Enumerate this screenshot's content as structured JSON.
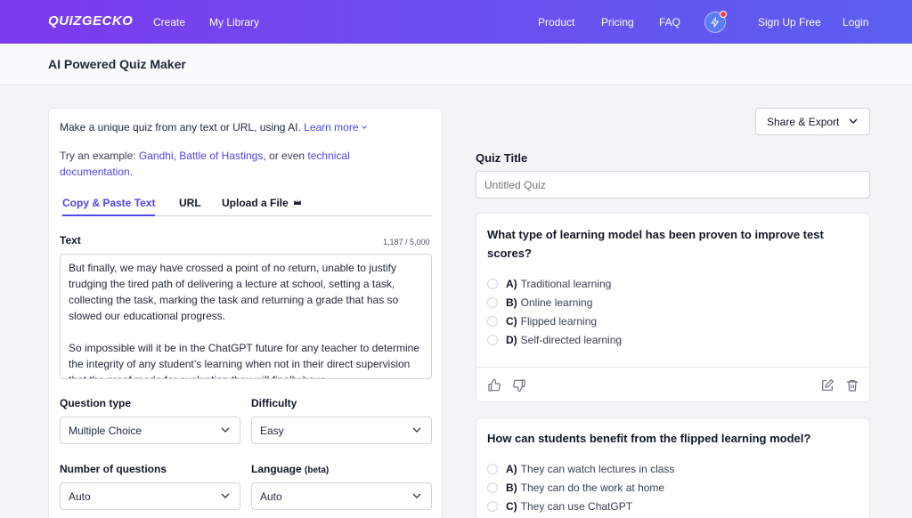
{
  "nav": {
    "logo": "QUIZGECKO",
    "create": "Create",
    "library": "My Library",
    "product": "Product",
    "pricing": "Pricing",
    "faq": "FAQ",
    "signup": "Sign Up Free",
    "login": "Login"
  },
  "header": {
    "title": "AI Powered Quiz Maker"
  },
  "intro": {
    "text": "Make a unique quiz from any text or URL, using AI. ",
    "learn_more": "Learn more",
    "try_prefix": "Try an example: ",
    "ex1": "Gandhi",
    "sep1": ", ",
    "ex2": "Battle of Hastings",
    "sep2": ", or even ",
    "ex3": "technical documentation",
    "end": "."
  },
  "tabs": {
    "paste": "Copy & Paste Text",
    "url": "URL",
    "upload": "Upload a File"
  },
  "text_field": {
    "label": "Text",
    "counter": "1,187 / 5,000",
    "para1": "But finally, we may have crossed a point of no return, unable to justify trudging the tired path of delivering a lecture at school, setting a task, collecting the task, marking the task and returning a grade that has so slowed our educational progress.",
    "para2": "So impossible will it be in the ChatGPT future for any teacher to determine the integrity of any student’s learning when not in their direct supervision that the proof mode for evaluation they will finally have"
  },
  "form": {
    "question_type_label": "Question type",
    "question_type_value": "Multiple Choice",
    "difficulty_label": "Difficulty",
    "difficulty_value": "Easy",
    "num_questions_label": "Number of questions",
    "num_questions_value": "Auto",
    "language_label": "Language",
    "language_beta": "(beta)",
    "language_value": "Auto"
  },
  "right": {
    "share_export": "Share & Export",
    "quiz_title_label": "Quiz Title",
    "quiz_title_placeholder": "Untitled Quiz"
  },
  "questions": [
    {
      "text": "What type of learning model has been proven to improve test scores?",
      "options": [
        {
          "letter": "A)",
          "text": "Traditional learning"
        },
        {
          "letter": "B)",
          "text": "Online learning"
        },
        {
          "letter": "C)",
          "text": "Flipped learning"
        },
        {
          "letter": "D)",
          "text": "Self-directed learning"
        }
      ]
    },
    {
      "text": "How can students benefit from the flipped learning model?",
      "options": [
        {
          "letter": "A)",
          "text": "They can watch lectures in class"
        },
        {
          "letter": "B)",
          "text": "They can do the work at home"
        },
        {
          "letter": "C)",
          "text": "They can use ChatGPT"
        }
      ]
    }
  ],
  "colors": {
    "accent": "#4f46e5",
    "nav_start": "#7c3aed",
    "nav_end": "#5b5ff0"
  }
}
